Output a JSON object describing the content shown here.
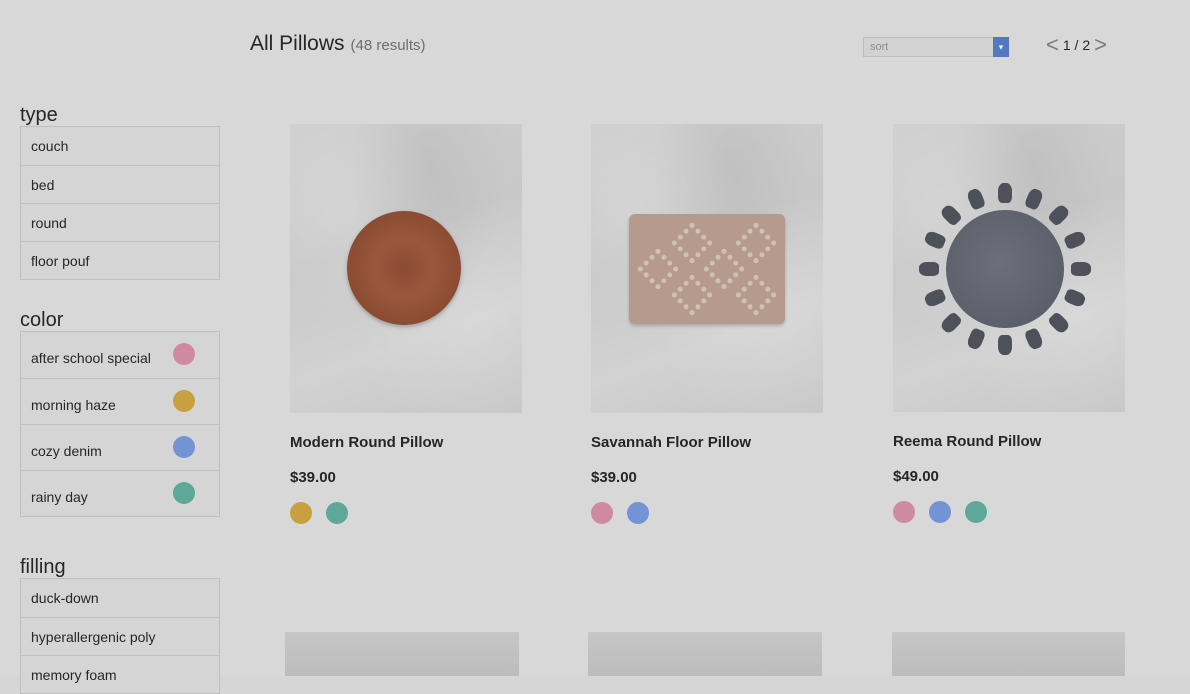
{
  "header": {
    "title": "All Pillows",
    "result_count": "(48 results)",
    "sort_placeholder": "sort",
    "pager": {
      "prev_icon": "chevron-left-icon",
      "text": "1 / 2",
      "next_icon": "chevron-right-icon"
    }
  },
  "filters": {
    "type": {
      "title": "type",
      "items": [
        "couch",
        "bed",
        "round",
        "floor pouf"
      ]
    },
    "color": {
      "title": "color",
      "items": [
        {
          "label": "after school special",
          "color": "#d08aa0"
        },
        {
          "label": "morning haze",
          "color": "#c9a040"
        },
        {
          "label": "cozy denim",
          "color": "#7393d4"
        },
        {
          "label": "rainy day",
          "color": "#5ea899"
        }
      ]
    },
    "filling": {
      "title": "filling",
      "items": [
        "duck-down",
        "hyperallergenic poly",
        "memory foam"
      ]
    }
  },
  "products": [
    {
      "name": "Modern Round Pillow",
      "price": "$39.00",
      "colors": [
        "#c9a040",
        "#5ea899"
      ]
    },
    {
      "name": "Savannah Floor Pillow",
      "price": "$39.00",
      "colors": [
        "#d08aa0",
        "#7393d4"
      ]
    },
    {
      "name": "Reema Round Pillow",
      "price": "$49.00",
      "colors": [
        "#d08aa0",
        "#7393d4",
        "#5ea899"
      ]
    }
  ]
}
